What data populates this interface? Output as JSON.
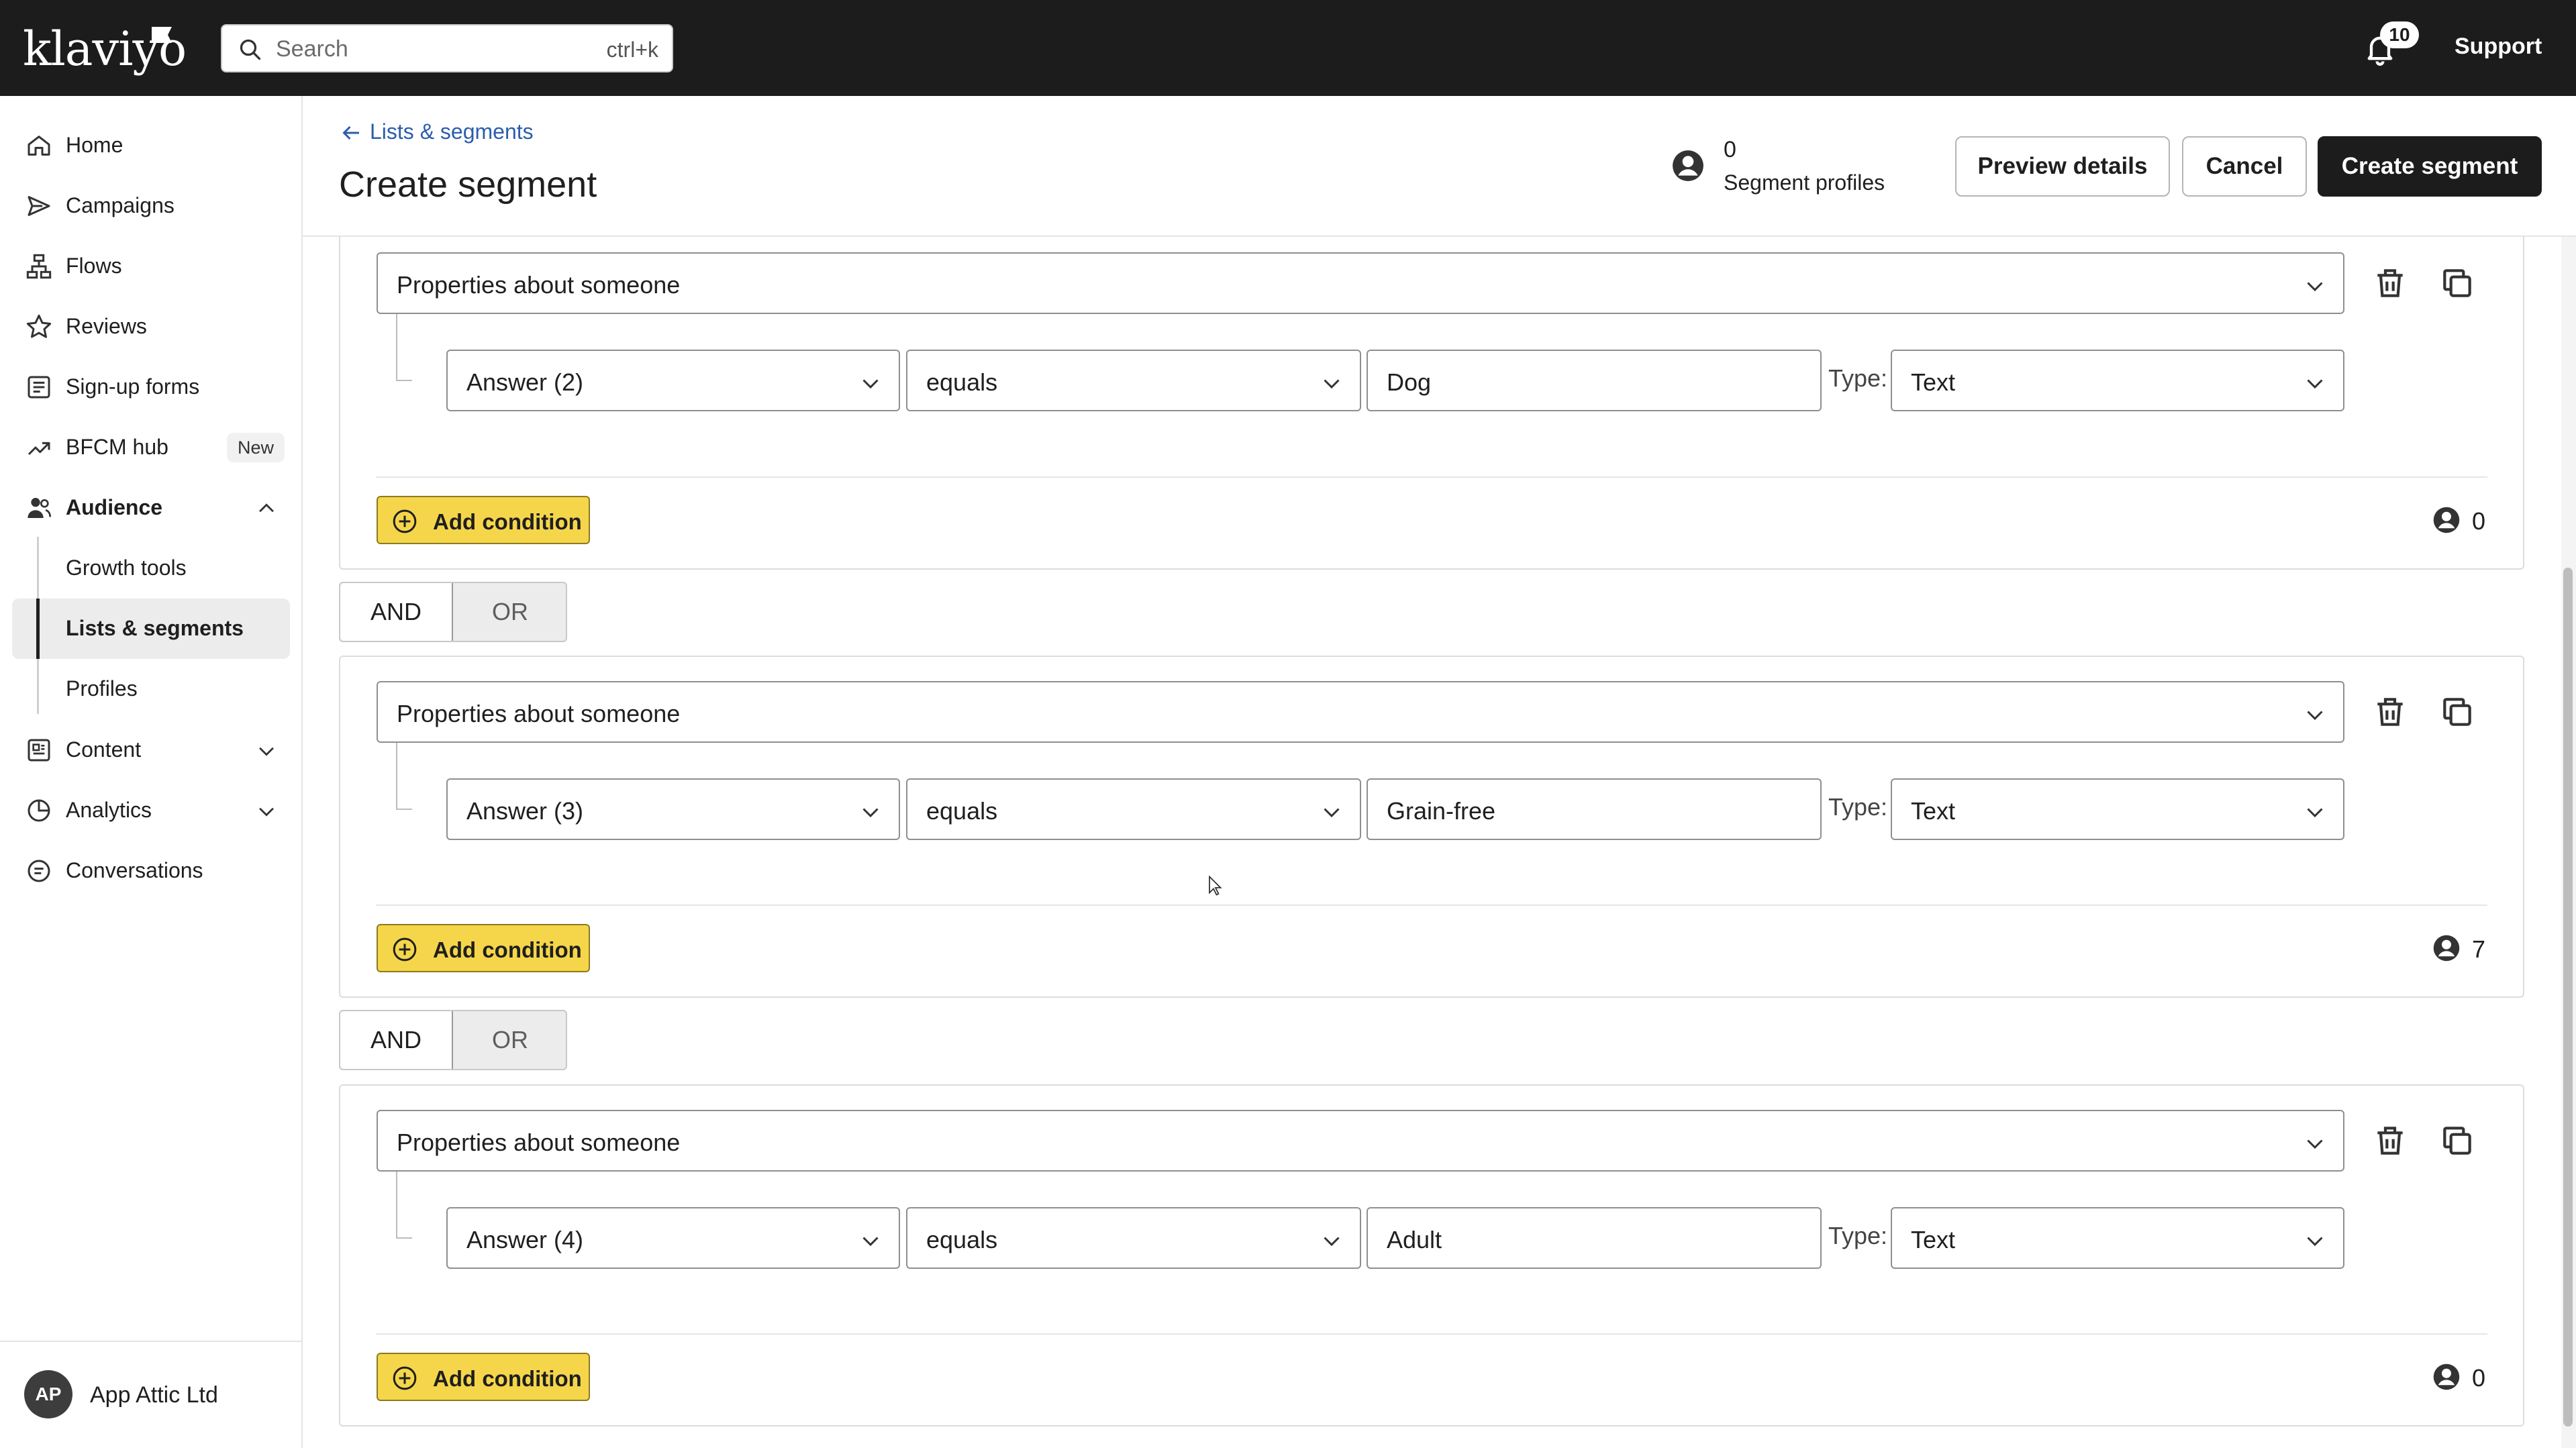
{
  "topbar": {
    "logo": "klaviyo",
    "search_placeholder": "Search",
    "search_shortcut": "ctrl+k",
    "notifications_count": "10",
    "support_label": "Support"
  },
  "sidebar": {
    "items": [
      {
        "label": "Home",
        "icon": "home-icon"
      },
      {
        "label": "Campaigns",
        "icon": "send-icon"
      },
      {
        "label": "Flows",
        "icon": "flows-icon"
      },
      {
        "label": "Reviews",
        "icon": "star-icon"
      },
      {
        "label": "Sign-up forms",
        "icon": "form-icon"
      },
      {
        "label": "BFCM hub",
        "icon": "trend-icon",
        "badge": "New"
      },
      {
        "label": "Audience",
        "icon": "audience-icon"
      },
      {
        "label": "Content",
        "icon": "content-icon"
      },
      {
        "label": "Analytics",
        "icon": "analytics-icon"
      },
      {
        "label": "Conversations",
        "icon": "chat-icon"
      }
    ],
    "audience_sub": [
      "Growth tools",
      "Lists & segments",
      "Profiles"
    ],
    "active_sub": "Lists & segments",
    "org": {
      "initials": "AP",
      "name": "App Attic Ltd"
    }
  },
  "header": {
    "breadcrumb": "Lists & segments",
    "title": "Create segment",
    "segment_count": "0",
    "segment_label": "Segment profiles",
    "preview_label": "Preview details",
    "cancel_label": "Cancel",
    "create_label": "Create segment"
  },
  "groups": [
    {
      "definition": "Properties about someone",
      "property": "Answer (2)",
      "operator": "equals",
      "value": "Dog",
      "type_label": "Type:",
      "type": "Text",
      "add_condition": "Add condition",
      "count": "0"
    },
    {
      "definition": "Properties about someone",
      "property": "Answer (3)",
      "operator": "equals",
      "value": "Grain-free",
      "type_label": "Type:",
      "type": "Text",
      "add_condition": "Add condition",
      "count": "7"
    },
    {
      "definition": "Properties about someone",
      "property": "Answer (4)",
      "operator": "equals",
      "value": "Adult",
      "type_label": "Type:",
      "type": "Text",
      "add_condition": "Add condition",
      "count": "0"
    }
  ],
  "connectors": [
    {
      "and": "AND",
      "or": "OR",
      "selected": "AND"
    },
    {
      "and": "AND",
      "or": "OR",
      "selected": "AND"
    }
  ],
  "colors": {
    "topbar": "#1c1c1c",
    "accent_yellow": "#f5d64a",
    "link_blue": "#2b5dae",
    "primary_button": "#1c1c1c"
  }
}
